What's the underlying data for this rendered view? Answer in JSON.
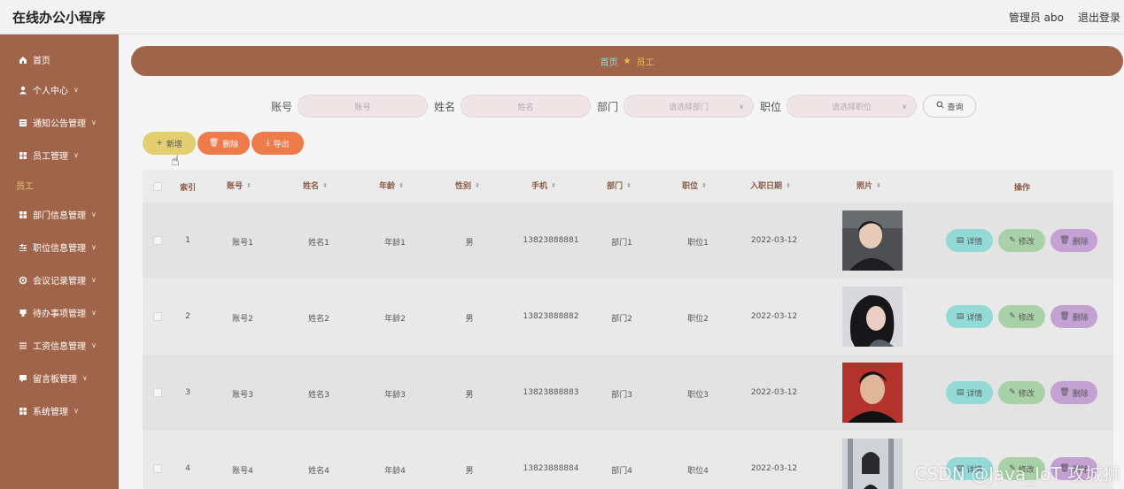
{
  "app": {
    "title": "在线办公小程序"
  },
  "header": {
    "user_label": "管理员 abo",
    "logout_label": "退出登录"
  },
  "sidebar": {
    "items": [
      {
        "label": "首页",
        "icon": "home-icon",
        "chevron": false
      },
      {
        "label": "个人中心",
        "icon": "user-icon",
        "chevron": true
      },
      {
        "label": "通知公告管理",
        "icon": "notice-icon",
        "chevron": true
      },
      {
        "label": "员工管理",
        "icon": "grid-icon",
        "chevron": true
      },
      {
        "label": "员工",
        "icon": "",
        "chevron": false,
        "sub": true
      },
      {
        "label": "部门信息管理",
        "icon": "grid-icon",
        "chevron": true
      },
      {
        "label": "职位信息管理",
        "icon": "sliders-icon",
        "chevron": true
      },
      {
        "label": "会议记录管理",
        "icon": "gear-icon",
        "chevron": true
      },
      {
        "label": "待办事项管理",
        "icon": "task-icon",
        "chevron": true
      },
      {
        "label": "工资信息管理",
        "icon": "list-icon",
        "chevron": true
      },
      {
        "label": "留言板管理",
        "icon": "message-icon",
        "chevron": true
      },
      {
        "label": "系统管理",
        "icon": "grid-icon",
        "chevron": true
      }
    ]
  },
  "breadcrumb": {
    "home": "首页",
    "current": "员工"
  },
  "search": {
    "account_label": "账号",
    "account_placeholder": "账号",
    "name_label": "姓名",
    "name_placeholder": "姓名",
    "dept_label": "部门",
    "dept_placeholder": "请选择部门",
    "position_label": "职位",
    "position_placeholder": "请选择职位",
    "query_label": "查询"
  },
  "actions": {
    "add": "新增",
    "delete": "删除",
    "export": "导出"
  },
  "table": {
    "columns": [
      "索引",
      "账号",
      "姓名",
      "年龄",
      "性别",
      "手机",
      "部门",
      "职位",
      "入职日期",
      "照片",
      "操作"
    ],
    "rows": [
      {
        "index": "1",
        "account": "账号1",
        "name": "姓名1",
        "age": "年龄1",
        "gender": "男",
        "phone": "13823888881",
        "dept": "部门1",
        "position": "职位1",
        "date": "2022-03-12"
      },
      {
        "index": "2",
        "account": "账号2",
        "name": "姓名2",
        "age": "年龄2",
        "gender": "男",
        "phone": "13823888882",
        "dept": "部门2",
        "position": "职位2",
        "date": "2022-03-12"
      },
      {
        "index": "3",
        "account": "账号3",
        "name": "姓名3",
        "age": "年龄3",
        "gender": "男",
        "phone": "13823888883",
        "dept": "部门3",
        "position": "职位3",
        "date": "2022-03-12"
      },
      {
        "index": "4",
        "account": "账号4",
        "name": "姓名4",
        "age": "年龄4",
        "gender": "男",
        "phone": "13823888884",
        "dept": "部门4",
        "position": "职位4",
        "date": "2022-03-12"
      }
    ],
    "op_detail": "详情",
    "op_edit": "修改",
    "op_delete": "删除"
  },
  "watermark": "CSDN @Java_IoT 攻城狮",
  "colors": {
    "sidebar": "#a0644a",
    "breadcrumb_home": "#7ee7d1",
    "breadcrumb_current": "#e9c340",
    "add_btn": "#e3cf6f",
    "delete_btn": "#ef7a4a",
    "detail_btn": "#93d9d6",
    "edit_btn": "#a9d1a7",
    "remove_btn": "#c3a1d2"
  }
}
